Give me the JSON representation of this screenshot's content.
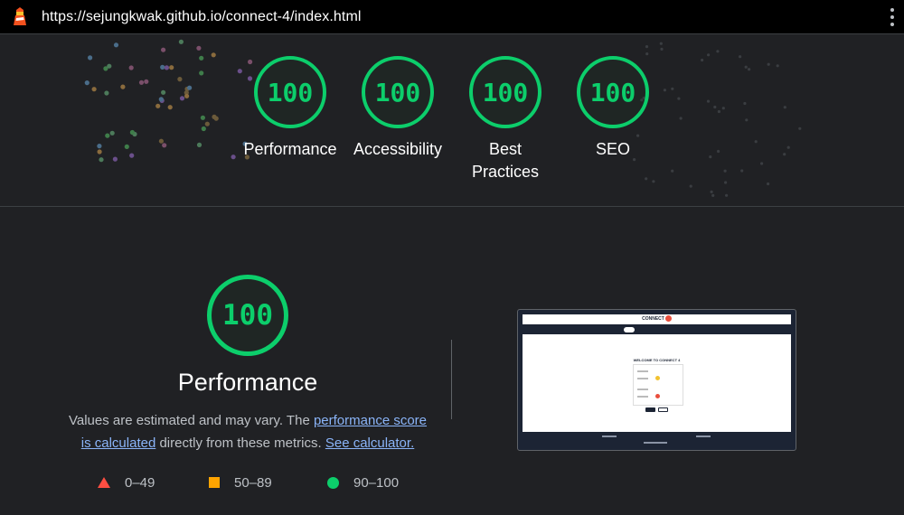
{
  "browser": {
    "url": "https://sejungkwak.github.io/connect-4/index.html",
    "logo_icon": "lighthouse-icon",
    "menu_icon": "kebab-menu-icon"
  },
  "colors": {
    "pass": "#0cce6b",
    "average": "#ffa400",
    "fail": "#ff4e42",
    "link": "#8ab4f8",
    "background": "#202124"
  },
  "scores": [
    {
      "value": "100",
      "label": "Performance"
    },
    {
      "value": "100",
      "label": "Accessibility"
    },
    {
      "value": "100",
      "label": "Best Practices"
    },
    {
      "value": "100",
      "label": "SEO"
    }
  ],
  "performance_section": {
    "score": "100",
    "title": "Performance",
    "description_prefix": "Values are estimated and may vary. The ",
    "link_score": "performance score is calculated",
    "description_middle": " directly from these metrics. ",
    "link_calculator": "See calculator."
  },
  "legend": [
    {
      "icon": "triangle-icon",
      "range": "0–49"
    },
    {
      "icon": "square-icon",
      "range": "50–89"
    },
    {
      "icon": "circle-icon",
      "range": "90–100"
    }
  ],
  "screenshot": {
    "brand": "CONNECT",
    "brand_badge": "4",
    "welcome": "WELCOME TO CONNECT 4"
  }
}
